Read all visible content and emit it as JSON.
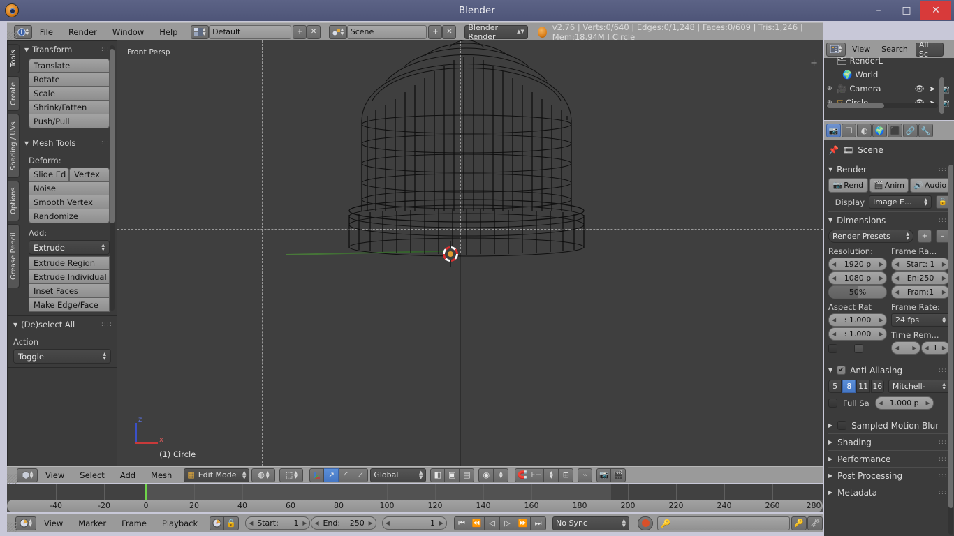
{
  "window": {
    "title": "Blender",
    "minimize_label": "–",
    "maximize_label": "□",
    "close_label": "✕"
  },
  "topbar": {
    "editor_icon": "info-editor-icon",
    "menus": [
      "File",
      "Render",
      "Window",
      "Help"
    ],
    "screen_layout": {
      "icon": "screen-layout-icon",
      "value": "Default",
      "add_label": "+",
      "remove_label": "✕"
    },
    "scene": {
      "icon": "scene-icon",
      "value": "Scene",
      "add_label": "+",
      "remove_label": "✕"
    },
    "render_engine": "Blender Render",
    "status": "v2.76 | Verts:0/640 | Edges:0/1,248 | Faces:0/609 | Tris:1,246 | Mem:18.94M | Circle"
  },
  "toolshelf": {
    "tabs": [
      {
        "label": "Tools",
        "active": true
      },
      {
        "label": "Create",
        "active": false
      },
      {
        "label": "Shading / UVs",
        "active": false
      },
      {
        "label": "Options",
        "active": false
      },
      {
        "label": "Grease Pencil",
        "active": false
      }
    ],
    "transform": {
      "title": "Transform",
      "buttons": [
        "Translate",
        "Rotate",
        "Scale",
        "Shrink/Fatten",
        "Push/Pull"
      ]
    },
    "mesh_tools": {
      "title": "Mesh Tools",
      "deform_label": "Deform:",
      "deform_row": [
        "Slide Ed",
        "Vertex"
      ],
      "deform_buttons": [
        "Noise",
        "Smooth Vertex",
        "Randomize"
      ],
      "add_label": "Add:",
      "add_dropdown": "Extrude",
      "add_buttons": [
        "Extrude Region",
        "Extrude Individual",
        "Inset Faces",
        "Make Edge/Face"
      ]
    }
  },
  "operator_panel": {
    "title": "(De)select All",
    "action_label": "Action",
    "action_value": "Toggle"
  },
  "viewport": {
    "view_name": "Front Persp",
    "object_label": "(1) Circle",
    "axis_z_label": "z",
    "axis_x_label": "x",
    "plus_label": "+"
  },
  "viewport_header": {
    "mode_icon": "object-mode-icon",
    "menus": [
      "View",
      "Select",
      "Add",
      "Mesh"
    ],
    "mode": "Edit Mode",
    "select_mode_icons": [
      "vertex-select-icon",
      "edge-select-icon",
      "face-select-icon"
    ],
    "pivot_icon": "pivot-icon",
    "manipulator_icons": [
      "translate-manipulator-icon",
      "rotate-manipulator-icon",
      "scale-manipulator-icon"
    ],
    "orientation": "Global",
    "shading_icons": [
      "wireframe-shading-icon",
      "solid-shading-icon",
      "texture-shading-icon"
    ],
    "snap_icon": "magnet-icon",
    "proportional_icon": "proportional-edit-icon",
    "render_icons": [
      "render-image-icon",
      "render-animation-icon"
    ]
  },
  "outliner": {
    "editor_icon": "outliner-editor-icon",
    "menus": [
      "View",
      "Search"
    ],
    "display_mode": "All Sc",
    "rows": [
      {
        "name": "RenderL",
        "icon": "renderlayers-icon"
      },
      {
        "name": "World",
        "icon": "world-icon"
      },
      {
        "name": "Camera",
        "icon": "camera-icon"
      },
      {
        "name": "Circle",
        "icon": "mesh-icon"
      }
    ],
    "row_icons": [
      "eye-icon",
      "cursor-arrow-icon",
      "camera-restrict-icon"
    ]
  },
  "properties": {
    "tabs": [
      {
        "name": "render-tab",
        "glyph": "📷",
        "active": true
      },
      {
        "name": "render-layers-tab",
        "glyph": "❐",
        "active": false
      },
      {
        "name": "scene-tab",
        "glyph": "◐",
        "active": false
      },
      {
        "name": "world-tab",
        "glyph": "🌍",
        "active": false
      },
      {
        "name": "object-tab",
        "glyph": "⬛",
        "active": false
      },
      {
        "name": "constraints-tab",
        "glyph": "🔗",
        "active": false
      },
      {
        "name": "modifiers-tab",
        "glyph": "🔧",
        "active": false
      }
    ],
    "breadcrumb": "Scene",
    "render": {
      "title": "Render",
      "buttons": [
        "Rend",
        "Anim",
        "Audio"
      ],
      "display_label": "Display",
      "display_value": "Image E..."
    },
    "dimensions": {
      "title": "Dimensions",
      "presets": "Render Presets",
      "preset_add": "+",
      "preset_remove": "–",
      "resolution_label": "Resolution:",
      "resolution_x": "1920 p",
      "resolution_y": "1080 p",
      "resolution_percent": "50%",
      "frame_range_label": "Frame Ra...",
      "frame_start": "Start: 1",
      "frame_end": "En:250",
      "frame_step": "Fram:1",
      "aspect_label": "Aspect Rat",
      "aspect_x": ": 1.000",
      "aspect_y": ": 1.000",
      "frame_rate_label": "Frame Rate:",
      "frame_rate": "24 fps",
      "time_remap_label": "Time Rem...",
      "time_remap_old": "",
      "time_remap_new": "1"
    },
    "anti_aliasing": {
      "title": "Anti-Aliasing",
      "enabled": true,
      "samples": [
        "5",
        "8",
        "11",
        "16"
      ],
      "active_sample": "8",
      "filter": "Mitchell-",
      "full_sample_label": "Full Sa",
      "filter_size": "1.000 p"
    },
    "collapsed": [
      {
        "label": "Sampled Motion Blur",
        "has_checkbox": true
      },
      {
        "label": "Shading",
        "has_checkbox": false
      },
      {
        "label": "Performance",
        "has_checkbox": false
      },
      {
        "label": "Post Processing",
        "has_checkbox": false
      },
      {
        "label": "Metadata",
        "has_checkbox": false
      }
    ]
  },
  "timeline": {
    "editor_icon": "timeline-editor-icon",
    "menus": [
      "View",
      "Marker",
      "Frame",
      "Playback"
    ],
    "auto_key_icon": "record-keying-icon",
    "lock_icon": "lock-icon",
    "start_label": "Start:",
    "start_value": "1",
    "end_label": "End:",
    "end_value": "250",
    "current_frame": "1",
    "transport": [
      "jump-start-icon",
      "prev-keyframe-icon",
      "play-reverse-icon",
      "play-icon",
      "next-keyframe-icon",
      "jump-end-icon"
    ],
    "sync_mode": "No Sync",
    "record_icon": "record-icon",
    "keying_set": "",
    "keying_icons": [
      "add-keyframe-icon",
      "remove-keyframe-icon"
    ],
    "ruler_labels": [
      "-40",
      "-20",
      "0",
      "20",
      "40",
      "60",
      "80",
      "100",
      "120",
      "140",
      "160",
      "180",
      "200",
      "220",
      "240",
      "260",
      "280"
    ],
    "playhead_frame": "0"
  },
  "colors": {
    "title_bar": "#5c6386",
    "header": "#9a9a9a",
    "panel": "#3b3b3b",
    "viewport": "#3f3f3f",
    "accent_blue": "#5b8fd8",
    "playhead_green": "#6fd44a",
    "axis_red": "#8c3a3a",
    "axis_green": "#4a7a3a",
    "close_red": "#d83a3a"
  }
}
